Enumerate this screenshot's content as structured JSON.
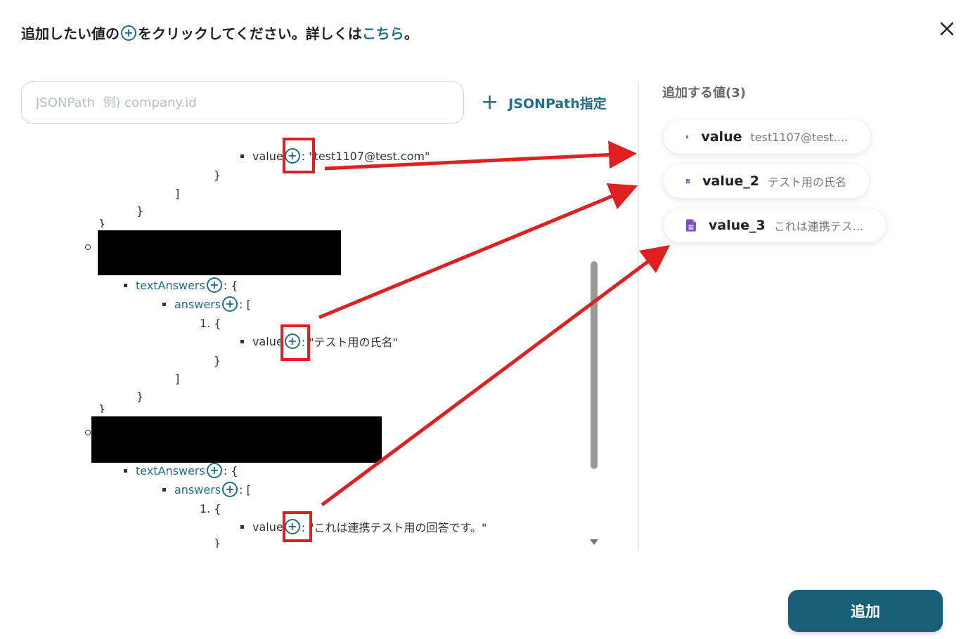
{
  "header": {
    "text_before": "追加したい値の",
    "plus_glyph": "+",
    "text_after": "をクリックしてください。詳しくは",
    "link_text": "こちら",
    "period": "。"
  },
  "close_glyph": "×",
  "search": {
    "placeholder": "JSONPath  例) company.id",
    "value": ""
  },
  "jsonpath_button": {
    "plus": "+",
    "label": "JSONPath指定"
  },
  "tree": {
    "value_key": "value",
    "text_answers_key": "textAnswers",
    "answers_key": "answers",
    "colon": ":",
    "open_brace_suffix": ": {",
    "open_bracket_suffix": ": [",
    "item_one": "1. {",
    "close_brace": "}",
    "close_bracket": "]",
    "value_1": ": \"test1107@test.com\"",
    "value_2": ": \"テスト用の氏名\"",
    "value_3": ": \"これは連携テスト用の回答です。\""
  },
  "values_panel": {
    "title": "追加する値(3)",
    "chips": [
      {
        "name": "value",
        "preview": "test1107@test...."
      },
      {
        "name": "value_2",
        "preview": "テスト用の氏名"
      },
      {
        "name": "value_3",
        "preview": "これは連携テス..."
      }
    ]
  },
  "add_button": {
    "label": "追加"
  },
  "colors": {
    "accent": "#1f6f86",
    "button_bg": "#185f78",
    "highlight": "#e02020",
    "doc_icon": "#7b4fc4"
  }
}
